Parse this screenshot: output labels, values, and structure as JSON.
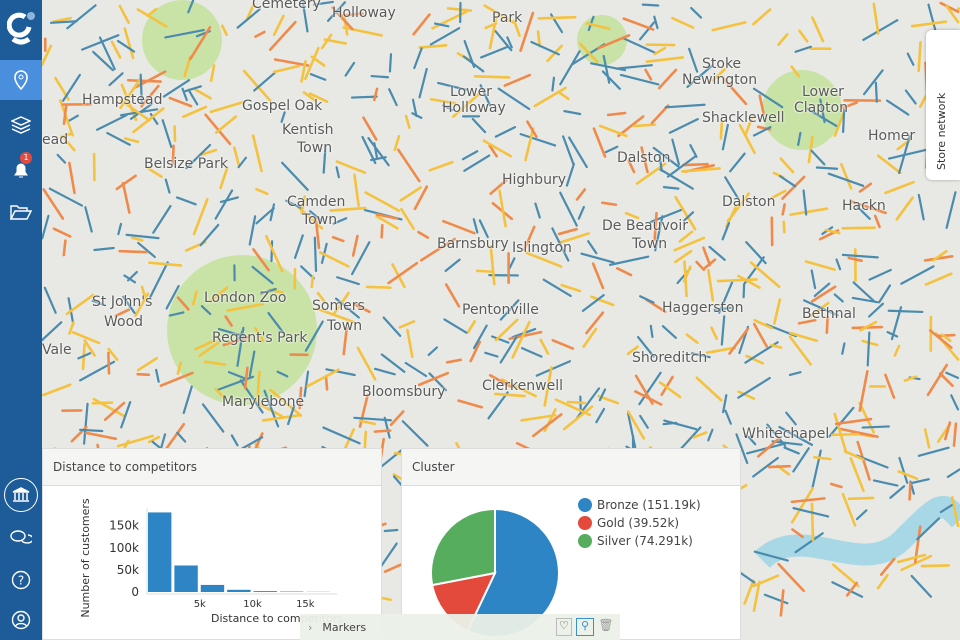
{
  "map": {
    "labels": [
      {
        "t": "Cemetery",
        "x": 210,
        "y": -4
      },
      {
        "t": "Holloway",
        "x": 290,
        "y": 5
      },
      {
        "t": "Park",
        "x": 450,
        "y": 10
      },
      {
        "t": "Hampstead",
        "x": 40,
        "y": 92
      },
      {
        "t": "Gospel Oak",
        "x": 200,
        "y": 98
      },
      {
        "t": "Kentish",
        "x": 240,
        "y": 122
      },
      {
        "t": "Town",
        "x": 255,
        "y": 140
      },
      {
        "t": "Lower",
        "x": 408,
        "y": 84
      },
      {
        "t": "Holloway",
        "x": 400,
        "y": 100
      },
      {
        "t": "Stoke",
        "x": 660,
        "y": 56
      },
      {
        "t": "Newington",
        "x": 640,
        "y": 72
      },
      {
        "t": "Shacklewell",
        "x": 660,
        "y": 110
      },
      {
        "t": "Lower",
        "x": 760,
        "y": 84
      },
      {
        "t": "Clapton",
        "x": 752,
        "y": 100
      },
      {
        "t": "Homer",
        "x": 826,
        "y": 128
      },
      {
        "t": "ead",
        "x": 0,
        "y": 132
      },
      {
        "t": "Belsize Park",
        "x": 102,
        "y": 156
      },
      {
        "t": "Dalston",
        "x": 575,
        "y": 150
      },
      {
        "t": "Highbury",
        "x": 460,
        "y": 172
      },
      {
        "t": "Camden",
        "x": 245,
        "y": 194
      },
      {
        "t": "Town",
        "x": 260,
        "y": 212
      },
      {
        "t": "Dalston",
        "x": 680,
        "y": 194
      },
      {
        "t": "Hackn",
        "x": 800,
        "y": 198
      },
      {
        "t": "De Beauvoir",
        "x": 560,
        "y": 218
      },
      {
        "t": "Town",
        "x": 590,
        "y": 236
      },
      {
        "t": "Barnsbury",
        "x": 395,
        "y": 236
      },
      {
        "t": "Islington",
        "x": 470,
        "y": 240
      },
      {
        "t": "London Zoo",
        "x": 162,
        "y": 290
      },
      {
        "t": "St John's",
        "x": 50,
        "y": 294
      },
      {
        "t": "Wood",
        "x": 62,
        "y": 314
      },
      {
        "t": "Somers",
        "x": 270,
        "y": 298
      },
      {
        "t": "Town",
        "x": 285,
        "y": 318
      },
      {
        "t": "Pentonville",
        "x": 420,
        "y": 302
      },
      {
        "t": "Haggerston",
        "x": 620,
        "y": 300
      },
      {
        "t": "Bethnal",
        "x": 760,
        "y": 306
      },
      {
        "t": "Vale",
        "x": 0,
        "y": 342
      },
      {
        "t": "Regent's Park",
        "x": 170,
        "y": 330
      },
      {
        "t": "Shoreditch",
        "x": 590,
        "y": 350
      },
      {
        "t": "Clerkenwell",
        "x": 440,
        "y": 378
      },
      {
        "t": "Marylebone",
        "x": 180,
        "y": 394
      },
      {
        "t": "Bloomsbury",
        "x": 320,
        "y": 384
      },
      {
        "t": "Whitechapel",
        "x": 700,
        "y": 426
      }
    ]
  },
  "sidebar": {
    "items": [
      {
        "icon": "map-pin-icon",
        "active": true
      },
      {
        "icon": "layers-icon"
      },
      {
        "icon": "bell-icon",
        "badge": "1"
      },
      {
        "icon": "folder-icon"
      }
    ],
    "bottom": [
      {
        "icon": "bank-icon"
      },
      {
        "icon": "chat-icon"
      },
      {
        "icon": "help-icon"
      },
      {
        "icon": "user-icon"
      }
    ]
  },
  "store_network_tab": "Store network",
  "markers_bar": {
    "label": "Markers"
  },
  "colors": {
    "sidebar": "#1d5b99",
    "active": "#4a8fdd",
    "bar": "#2e85c6",
    "bronze": "#2e85c6",
    "gold": "#e34a3c",
    "silver": "#55ad5d"
  },
  "chart_data": [
    {
      "type": "bar",
      "title": "Distance to competitors",
      "xlabel": "Distance to competitors",
      "ylabel": "Number of customers",
      "bins": [
        [
          0,
          2500
        ],
        [
          2500,
          5000
        ],
        [
          5000,
          7500
        ],
        [
          7500,
          10000
        ],
        [
          10000,
          12500
        ],
        [
          12500,
          15000
        ],
        [
          15000,
          17500
        ]
      ],
      "values": [
        180000,
        60000,
        16000,
        5000,
        2000,
        1000,
        400
      ],
      "xticks": [
        "5k",
        "10k",
        "15k"
      ],
      "yticks": [
        "0",
        "50k",
        "100k",
        "150k"
      ],
      "xlim": [
        0,
        18000
      ],
      "ylim": [
        0,
        190000
      ]
    },
    {
      "type": "pie",
      "title": "Cluster",
      "slices": [
        {
          "name": "Bronze (151.19k)",
          "value": 151.19,
          "color": "#2e85c6"
        },
        {
          "name": "Gold (39.52k)",
          "value": 39.52,
          "color": "#e34a3c"
        },
        {
          "name": "Silver (74.291k)",
          "value": 74.291,
          "color": "#55ad5d"
        }
      ]
    }
  ]
}
